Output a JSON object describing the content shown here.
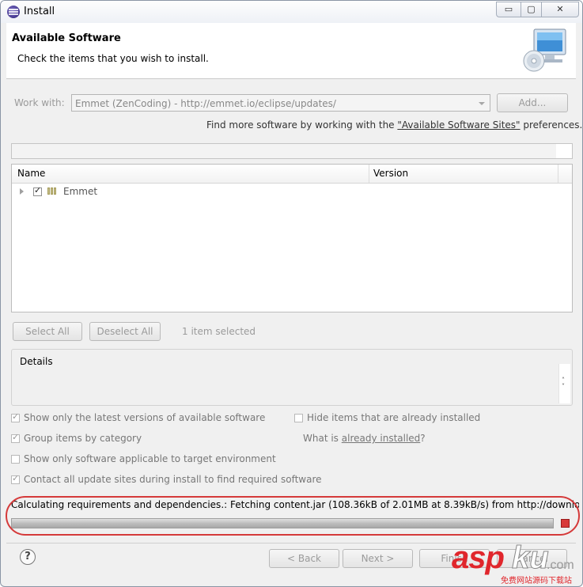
{
  "window": {
    "title": "Install",
    "controls": {
      "minimize": "▭",
      "maximize": "▢",
      "close": "✕"
    }
  },
  "header": {
    "title": "Available Software",
    "subtitle": "Check the items that you wish to install."
  },
  "work_with": {
    "label": "Work with:",
    "value": "Emmet (ZenCoding) - http://emmet.io/eclipse/updates/",
    "add_label": "Add..."
  },
  "find_more": {
    "prefix": "Find more software by working with the ",
    "link": "\"Available Software Sites\"",
    "suffix": " preferences."
  },
  "tree": {
    "columns": [
      "Name",
      "Version"
    ],
    "rows": [
      {
        "name": "Emmet",
        "checked": true,
        "version": ""
      }
    ]
  },
  "selection": {
    "select_all_label": "Select All",
    "deselect_all_label": "Deselect All",
    "status": "1 item selected"
  },
  "details": {
    "label": "Details",
    "scroll_up": "˄",
    "scroll_down": "˅"
  },
  "options": {
    "latest_versions": {
      "label": "Show only the latest versions of available software",
      "checked": true
    },
    "hide_installed": {
      "label": "Hide items that are already installed",
      "checked": false
    },
    "group_by_category": {
      "label": "Group items by category",
      "checked": true
    },
    "what_is_prefix": "What is ",
    "what_is_link": "already installed",
    "what_is_suffix": "?",
    "target_env": {
      "label": "Show only software applicable to target environment",
      "checked": false
    },
    "contact_sites": {
      "label": "Contact all update sites during install to find required software",
      "checked": true
    }
  },
  "progress": {
    "text": "Calculating requirements and dependencies.: Fetching content.jar (108.36kB of 2.01MB at 8.39kB/s) from http://download.e",
    "fraction": 1.0
  },
  "footer": {
    "help": "?",
    "back_label": "< Back",
    "next_label": "Next >",
    "finish_label": "Finish",
    "cancel_label": "Cancel"
  },
  "watermark": {
    "brand_a": "asp",
    "brand_b": "ku",
    "suffix": ".com",
    "cn": "免费网站源码下载站"
  },
  "colors": {
    "window_bg": "#f0f0f0",
    "highlight_ring": "#d53a3a",
    "watermark_red": "#e0262c"
  }
}
